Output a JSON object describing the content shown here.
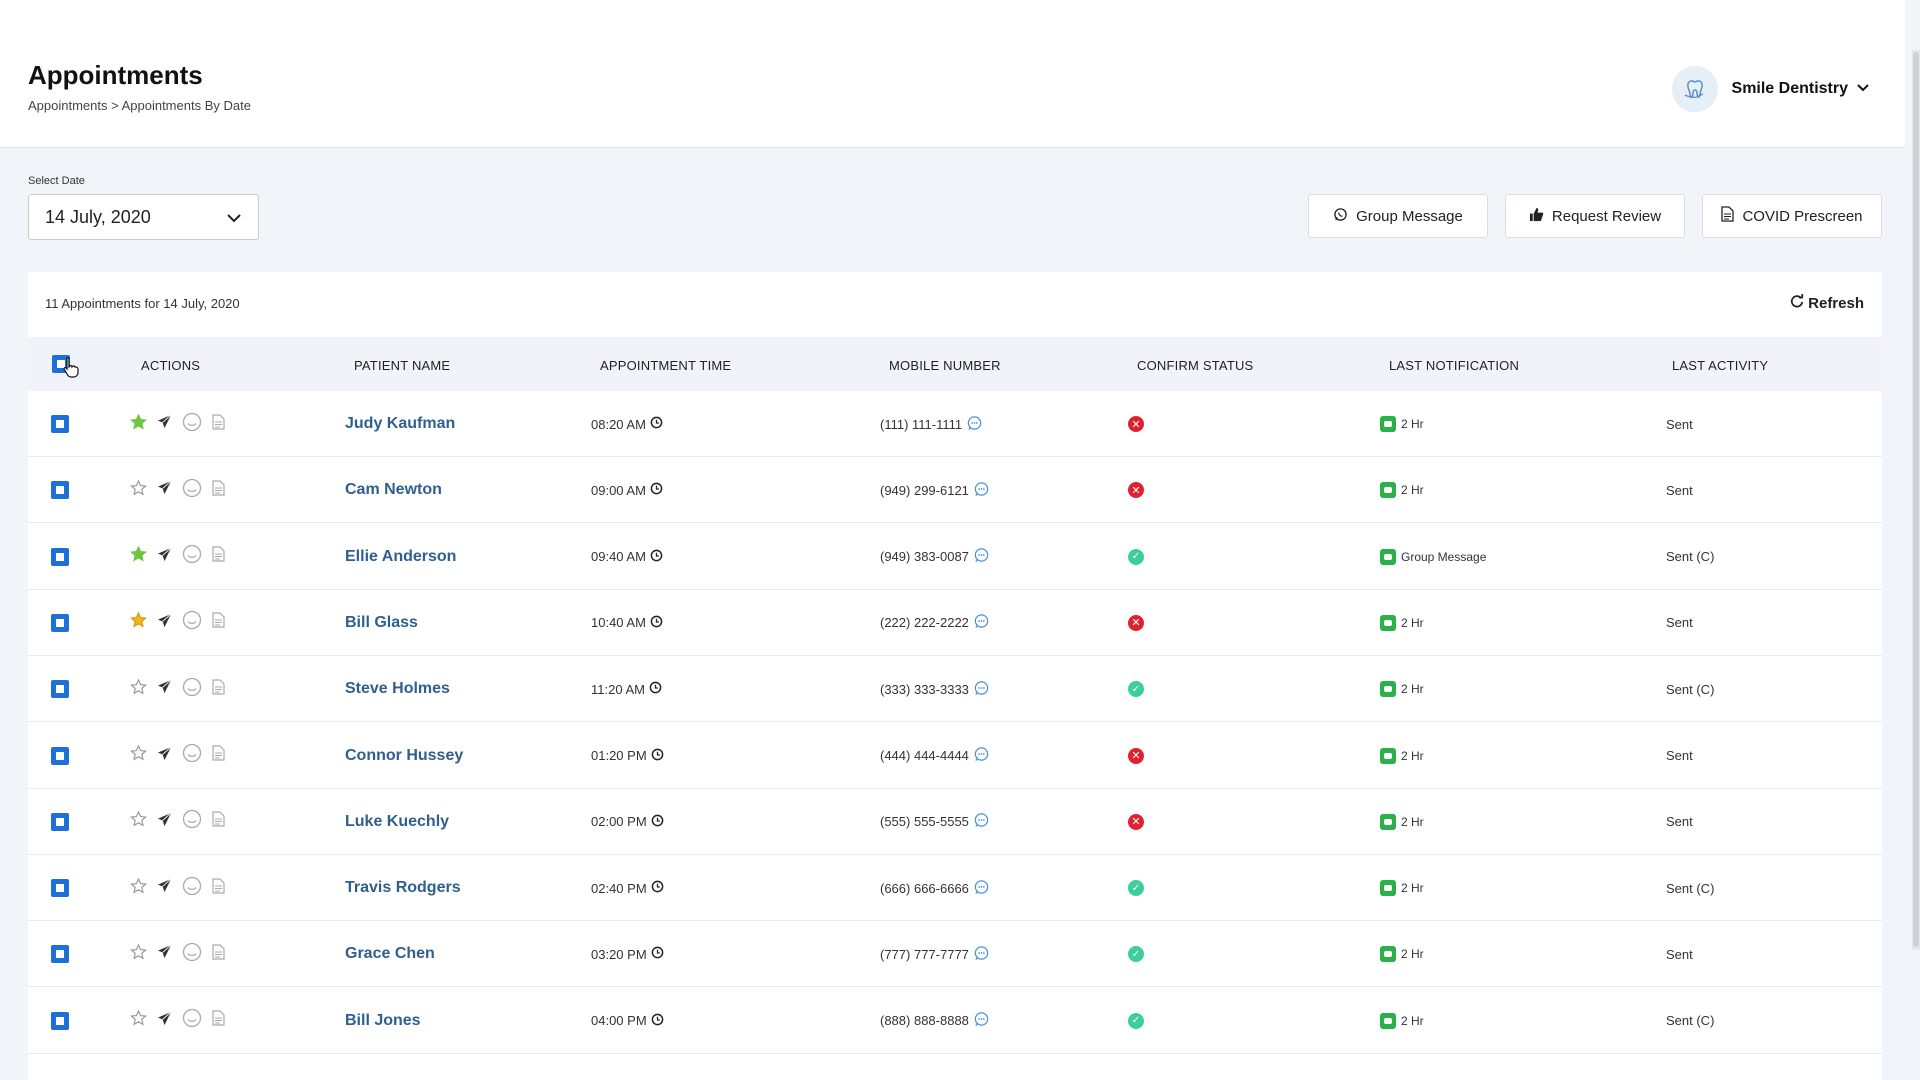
{
  "header": {
    "title": "Appointments",
    "breadcrumb": "Appointments > Appointments By Date",
    "practice_name": "Smile Dentistry"
  },
  "filters": {
    "date_label": "Select Date",
    "date_value": "14 July, 2020"
  },
  "toolbar": {
    "group_message": "Group Message",
    "request_review": "Request Review",
    "covid_prescreen": "COVID Prescreen"
  },
  "summary": {
    "count_text": "11 Appointments for 14 July, 2020",
    "refresh": "Refresh"
  },
  "table": {
    "columns": [
      "ACTIONS",
      "PATIENT NAME",
      "APPOINTMENT TIME",
      "MOBILE NUMBER",
      "CONFIRM STATUS",
      "LAST NOTIFICATION",
      "LAST ACTIVITY"
    ],
    "rows": [
      {
        "star": "green",
        "name": "Judy Kaufman",
        "time": "08:20 AM",
        "mobile": "(111) 111-1111",
        "confirmed": false,
        "notification": "2 Hr",
        "activity": "Sent"
      },
      {
        "star": "empty",
        "name": "Cam Newton",
        "time": "09:00 AM",
        "mobile": "(949) 299-6121",
        "confirmed": false,
        "notification": "2 Hr",
        "activity": "Sent"
      },
      {
        "star": "green",
        "name": "Ellie Anderson",
        "time": "09:40 AM",
        "mobile": "(949) 383-0087",
        "confirmed": true,
        "notification": "Group Message",
        "activity": "Sent (C)"
      },
      {
        "star": "gold",
        "name": "Bill Glass",
        "time": "10:40 AM",
        "mobile": "(222) 222-2222",
        "confirmed": false,
        "notification": "2 Hr",
        "activity": "Sent"
      },
      {
        "star": "empty",
        "name": "Steve Holmes",
        "time": "11:20 AM",
        "mobile": "(333) 333-3333",
        "confirmed": true,
        "notification": "2 Hr",
        "activity": "Sent (C)"
      },
      {
        "star": "empty",
        "name": "Connor Hussey",
        "time": "01:20 PM",
        "mobile": "(444) 444-4444",
        "confirmed": false,
        "notification": "2 Hr",
        "activity": "Sent"
      },
      {
        "star": "empty",
        "name": "Luke Kuechly",
        "time": "02:00 PM",
        "mobile": "(555) 555-5555",
        "confirmed": false,
        "notification": "2 Hr",
        "activity": "Sent"
      },
      {
        "star": "empty",
        "name": "Travis Rodgers",
        "time": "02:40 PM",
        "mobile": "(666) 666-6666",
        "confirmed": true,
        "notification": "2 Hr",
        "activity": "Sent (C)"
      },
      {
        "star": "empty",
        "name": "Grace Chen",
        "time": "03:20 PM",
        "mobile": "(777) 777-7777",
        "confirmed": true,
        "notification": "2 Hr",
        "activity": "Sent"
      },
      {
        "star": "empty",
        "name": "Bill Jones",
        "time": "04:00 PM",
        "mobile": "(888) 888-8888",
        "confirmed": true,
        "notification": "2 Hr",
        "activity": "Sent (C)"
      }
    ]
  },
  "colors": {
    "accent": "#1e6fd6",
    "link": "#2f5f8f",
    "star_green": "#6cc63f",
    "star_gold": "#f2b41e",
    "status_declined": "#e0212f",
    "status_confirmed": "#3ccf9a",
    "notification": "#2bb04a"
  }
}
